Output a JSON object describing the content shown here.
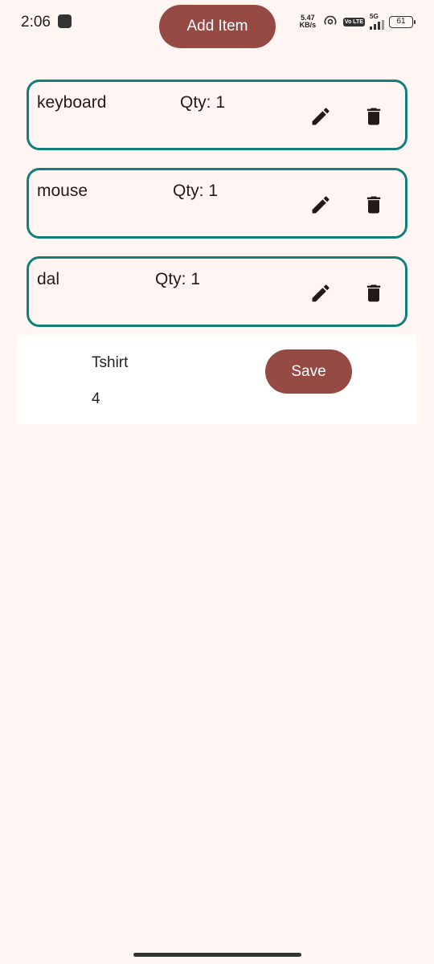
{
  "status_bar": {
    "time": "2:06",
    "net_speed_value": "5.47",
    "net_speed_unit": "KB/s",
    "volte": "Vo LTE",
    "network": "5G",
    "battery": "61"
  },
  "header": {
    "add_item_label": "Add Item"
  },
  "items": [
    {
      "name": "keyboard",
      "qty": "Qty: 1"
    },
    {
      "name": "mouse",
      "qty": "Qty: 1"
    },
    {
      "name": "dal",
      "qty": "Qty: 1"
    }
  ],
  "editor": {
    "name_value": "Tshirt",
    "qty_value": "4",
    "save_label": "Save"
  },
  "colors": {
    "primary": "#954a44",
    "card_border": "#127f78",
    "background": "#fff6f4"
  },
  "icons": [
    "edit-icon",
    "delete-icon",
    "hotspot-icon",
    "signal-icon",
    "battery-icon"
  ]
}
